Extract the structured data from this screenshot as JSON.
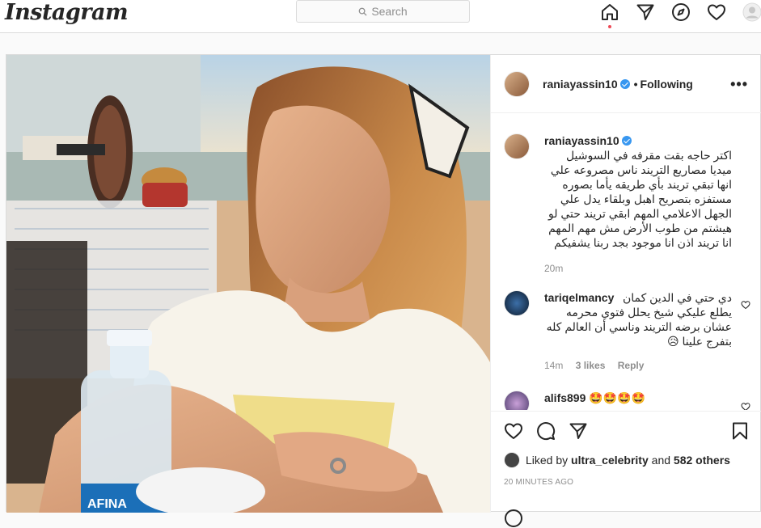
{
  "app": {
    "logo": "Instagram"
  },
  "search": {
    "placeholder": "Search"
  },
  "nav": {
    "icons": [
      "home-icon",
      "direct-icon",
      "explore-icon",
      "activity-heart-icon",
      "profile-avatar"
    ]
  },
  "post": {
    "author": "raniayassin10",
    "separator": "•",
    "follow_status": "Following",
    "more_label": "•••",
    "caption": {
      "user": "raniayassin10",
      "text": "اكتر حاجه بقت مقرفه في السوشيل ميديا مصاريع التريند ناس مصروعه علي انها تبقي تريند بأي طريقه يأما بصوره مستفزه بتصريح اهبل وبلقاء يدل علي الجهل الاعلامي المهم ابقي تريند حتي لو هيشتم من طوب الأرض مش مهم المهم انا تريند اذن انا موجود بجد ربنا يشفيكم",
      "age": "20m"
    },
    "comments": [
      {
        "user": "tariqelmancy",
        "text": "دي حتي في الدين كمان يطلع عليكي شيخ يحلل فتوي محرمه عشان برضه التريند وناسي أن العالم كله بتفرج علينا 😥",
        "age": "14m",
        "likes": "3 likes",
        "reply": "Reply"
      },
      {
        "user": "alifs899",
        "text": "🤩🤩🤩🤩"
      }
    ],
    "liked_by_prefix": "Liked by",
    "liked_by_user": "ultra_celebrity",
    "liked_by_and": "and",
    "liked_by_others": "582 others",
    "timestamp": "20 MINUTES AGO",
    "bottle_label": "AFINA"
  },
  "colors": {
    "verified": "#3897f0",
    "border": "#dbdbdb",
    "muted": "#8e8e8e",
    "notif_dot": "#ed4956"
  }
}
